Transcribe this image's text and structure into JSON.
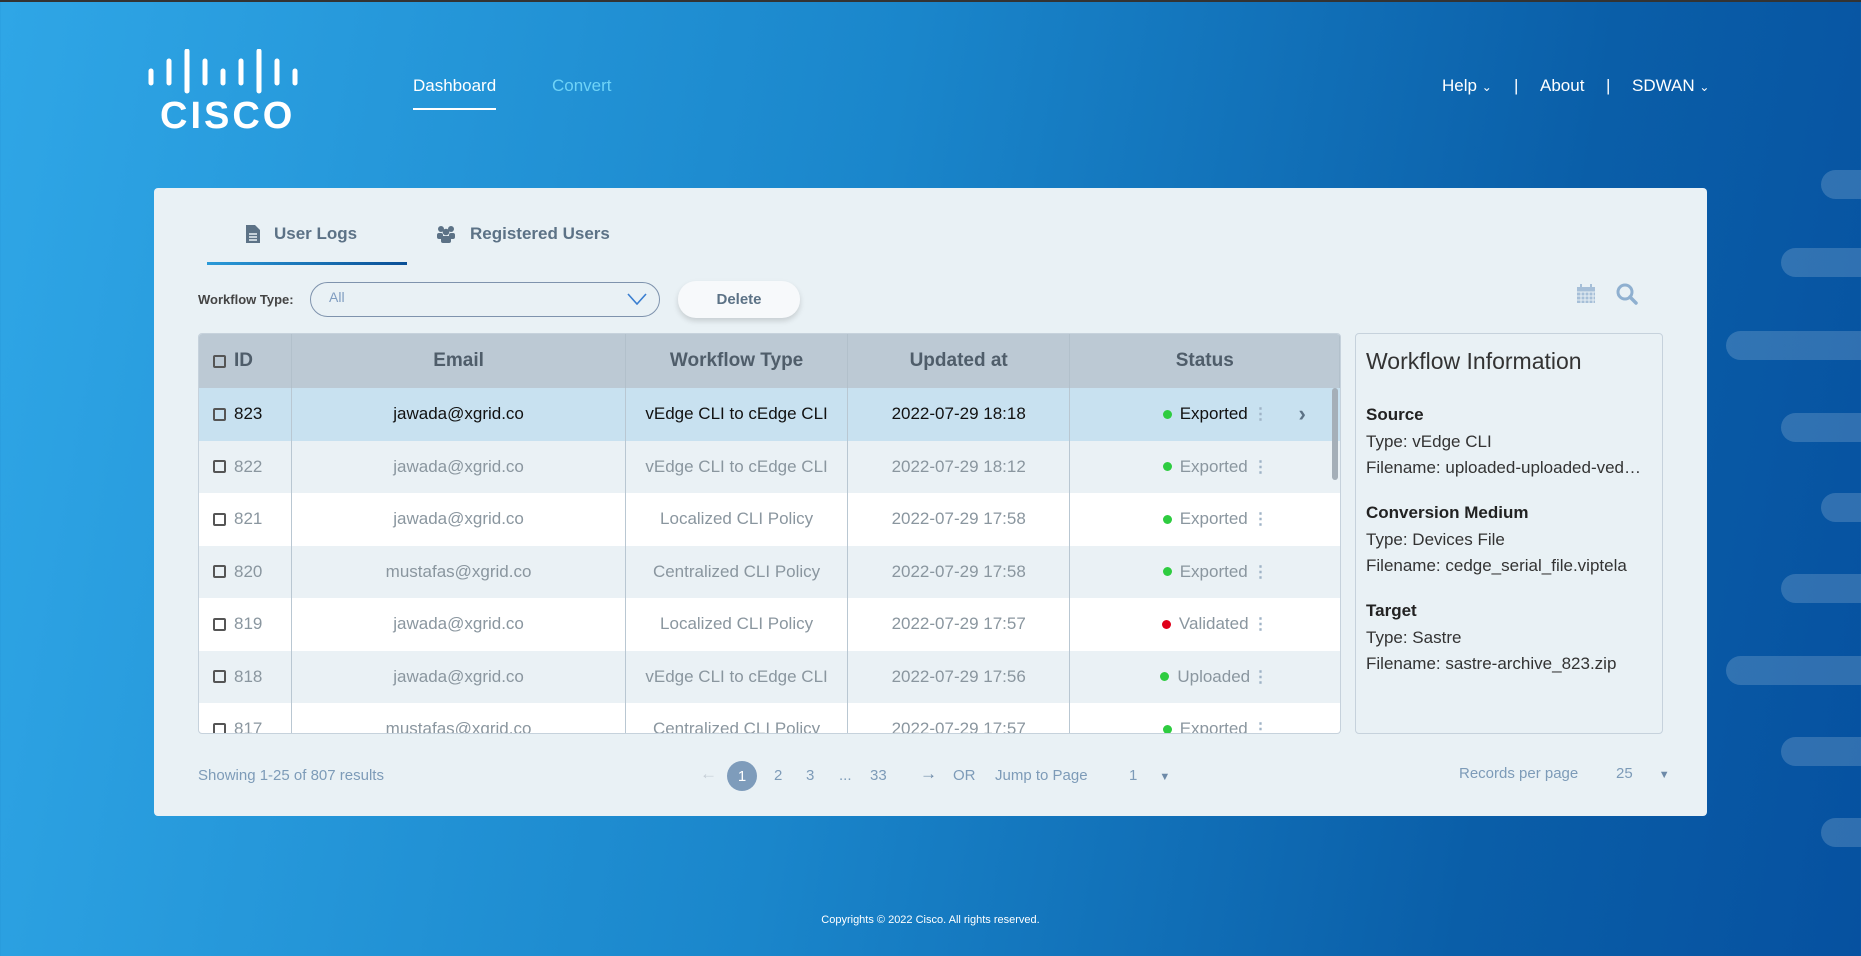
{
  "brand": {
    "logo_text": "CISCO"
  },
  "nav": {
    "dashboard": "Dashboard",
    "convert": "Convert",
    "help": "Help",
    "about": "About",
    "sdwan": "SDWAN",
    "separator": "|"
  },
  "tabs": [
    {
      "label": "User Logs",
      "icon": "file-icon",
      "active": true
    },
    {
      "label": "Registered Users",
      "icon": "users-icon",
      "active": false
    }
  ],
  "filter": {
    "label": "Workflow Type:",
    "value": "All",
    "delete_label": "Delete"
  },
  "table": {
    "columns": [
      "ID",
      "Email",
      "Workflow Type",
      "Updated at",
      "Status"
    ],
    "rows": [
      {
        "id": "823",
        "email": "jawada@xgrid.co",
        "type": "vEdge CLI to cEdge CLI",
        "updated": "2022-07-29 18:18",
        "status": "Exported",
        "status_color": "#2ecc40",
        "selected": true
      },
      {
        "id": "822",
        "email": "jawada@xgrid.co",
        "type": "vEdge CLI to cEdge CLI",
        "updated": "2022-07-29 18:12",
        "status": "Exported",
        "status_color": "#2ecc40"
      },
      {
        "id": "821",
        "email": "jawada@xgrid.co",
        "type": "Localized CLI Policy",
        "updated": "2022-07-29 17:58",
        "status": "Exported",
        "status_color": "#2ecc40"
      },
      {
        "id": "820",
        "email": "mustafas@xgrid.co",
        "type": "Centralized CLI Policy",
        "updated": "2022-07-29 17:58",
        "status": "Exported",
        "status_color": "#2ecc40"
      },
      {
        "id": "819",
        "email": "jawada@xgrid.co",
        "type": "Localized CLI Policy",
        "updated": "2022-07-29 17:57",
        "status": "Validated",
        "status_color": "#e0001a"
      },
      {
        "id": "818",
        "email": "jawada@xgrid.co",
        "type": "vEdge CLI to cEdge CLI",
        "updated": "2022-07-29 17:56",
        "status": "Uploaded",
        "status_color": "#2ecc40"
      },
      {
        "id": "817",
        "email": "mustafas@xgrid.co",
        "type": "Centralized CLI Policy",
        "updated": "2022-07-29 17:57",
        "status": "Exported",
        "status_color": "#2ecc40"
      }
    ]
  },
  "info": {
    "title": "Workflow Information",
    "source": {
      "heading": "Source",
      "type": "Type: vEdge CLI",
      "filename": "Filename: uploaded-uploaded-ved…"
    },
    "medium": {
      "heading": "Conversion Medium",
      "type": "Type: Devices File",
      "filename": "Filename: cedge_serial_file.viptela"
    },
    "target": {
      "heading": "Target",
      "type": "Type: Sastre",
      "filename": "Filename: sastre-archive_823.zip"
    }
  },
  "pagination": {
    "summary": "Showing 1-25 of 807 results",
    "pages": [
      "1",
      "2",
      "3",
      "...",
      "33"
    ],
    "current": "1",
    "or": "OR",
    "jump_label": "Jump to Page",
    "jump_value": "1",
    "records_label": "Records per page",
    "records_value": "25"
  },
  "footer": "Copyrights © 2022 Cisco. All rights reserved."
}
